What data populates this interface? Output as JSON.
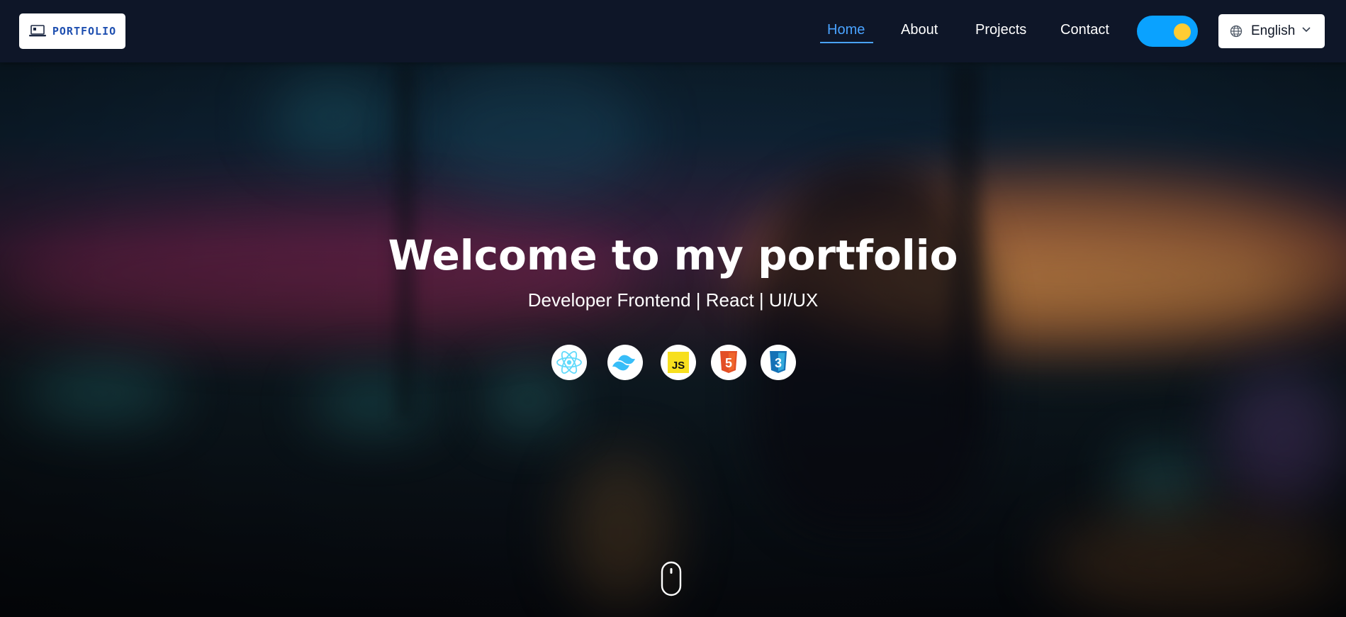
{
  "brand": {
    "logo_text": "PORTFOLIO",
    "logo_icon": "laptop-icon"
  },
  "nav": {
    "items": [
      {
        "label": "Home",
        "active": true
      },
      {
        "label": "About",
        "active": false
      },
      {
        "label": "Projects",
        "active": false
      },
      {
        "label": "Contact",
        "active": false
      }
    ]
  },
  "theme_toggle": {
    "state": "on",
    "icon": "sun-icon"
  },
  "language": {
    "selected": "English",
    "icon": "globe-icon"
  },
  "hero": {
    "title": "Welcome to my portfolio",
    "subtitle": "Developer Frontend | React | UI/UX",
    "tech_icons": [
      {
        "name": "react-icon",
        "color": "#61dafb"
      },
      {
        "name": "tailwind-icon",
        "color": "#38bdf8"
      },
      {
        "name": "javascript-icon",
        "label": "JS",
        "color": "#f7df1e"
      },
      {
        "name": "html5-icon",
        "label": "5",
        "color": "#e34f26"
      },
      {
        "name": "css3-icon",
        "label": "3",
        "color": "#1572b6"
      }
    ],
    "scroll_icon": "mouse-scroll-icon"
  },
  "colors": {
    "navbar_bg": "#0e1628",
    "accent": "#4aa3ff",
    "toggle_bg": "#0aa2ff",
    "toggle_knob": "#ffcc33",
    "logo_text": "#1e4fb0"
  }
}
